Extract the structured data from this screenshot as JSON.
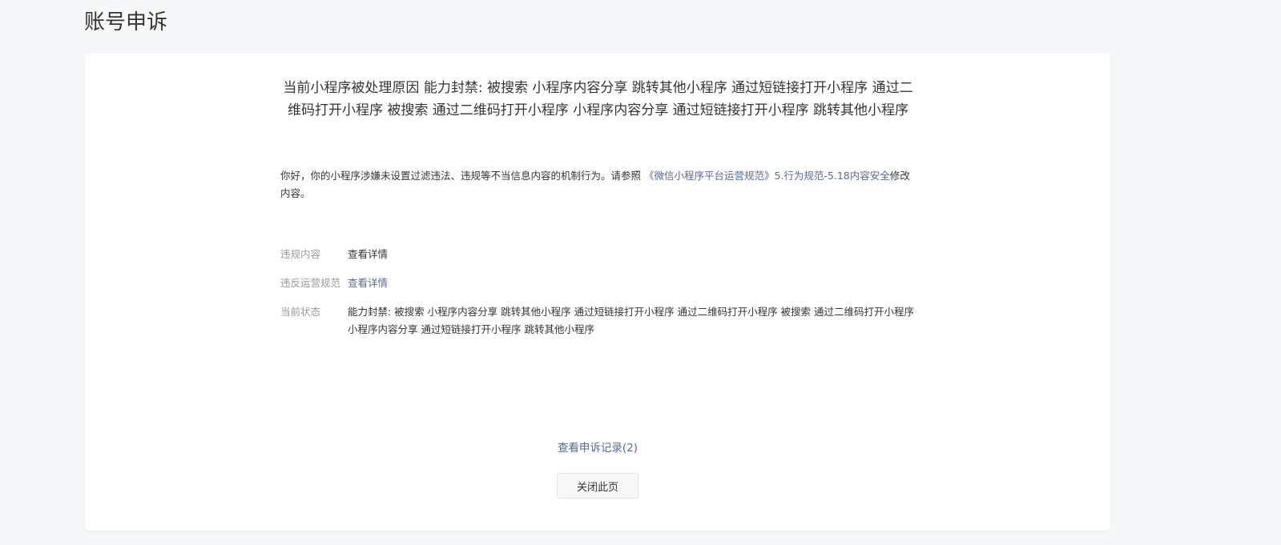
{
  "page": {
    "title": "账号申诉"
  },
  "appeal": {
    "headline": "当前小程序被处理原因 能力封禁: 被搜索 小程序内容分享 跳转其他小程序 通过短链接打开小程序 通过二维码打开小程序 被搜索 通过二维码打开小程序 小程序内容分享 通过短链接打开小程序 跳转其他小程序",
    "notice_prefix": "你好，你的小程序涉嫌未设置过滤违法、违规等不当信息内容的机制行为。请参照 ",
    "notice_link": "《微信小程序平台运营规范》5.行为规范-5.18内容安全",
    "notice_suffix": "修改内容。"
  },
  "details": {
    "violation_content": {
      "label": "违规内容",
      "value": "查看详情"
    },
    "violated_rule": {
      "label": "违反运营规范",
      "value": "查看详情"
    },
    "current_status": {
      "label": "当前状态",
      "value": "能力封禁: 被搜索 小程序内容分享 跳转其他小程序 通过短链接打开小程序 通过二维码打开小程序 被搜索 通过二维码打开小程序 小程序内容分享 通过短链接打开小程序 跳转其他小程序"
    }
  },
  "actions": {
    "view_records": "查看申诉记录(2)",
    "close_page": "关闭此页"
  },
  "colors": {
    "link": "#576b95",
    "label": "#9a9a9a",
    "text": "#353535",
    "background": "#f6f7f9"
  }
}
